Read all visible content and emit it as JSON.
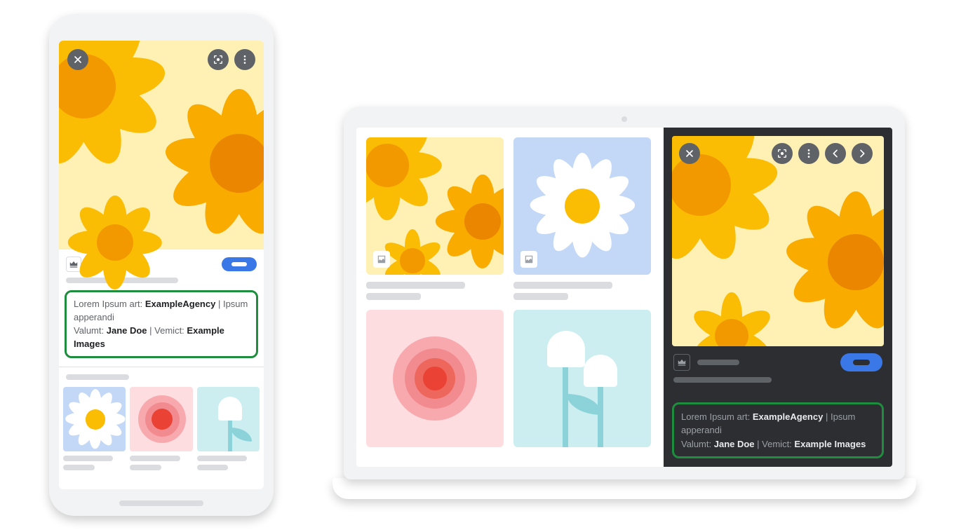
{
  "colors": {
    "highlight_border": "#1e8e3e",
    "action_pill": "#3b78e7",
    "icon_bg": "#5f6368",
    "viewer_bg": "#2d2e31",
    "skeleton": "#dadce0"
  },
  "credit": {
    "label_art": "Lorem Ipsum art:",
    "agency": "ExampleAgency",
    "separator": " | ",
    "label_apperandi": "Ipsum apperandi",
    "label_valumt": "Valumt:",
    "author": "Jane Doe",
    "label_vemict": "Vemict:",
    "source": "Example Images"
  },
  "icons": {
    "close": "close-icon",
    "lens": "lens-icon",
    "more": "more-vertical-icon",
    "prev": "chevron-left-icon",
    "next": "chevron-right-icon",
    "crown": "crown-icon",
    "image": "image-icon"
  }
}
